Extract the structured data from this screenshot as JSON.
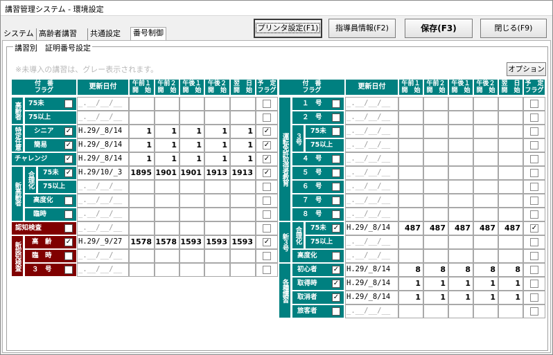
{
  "window": {
    "title": "講習管理システム - 環境設定"
  },
  "buttons": {
    "printer": "プリンタ設定(F1)",
    "instructor": "指導員情報(F2)",
    "save": "保存(F3)",
    "close": "閉じる(F9)",
    "option": "オプション"
  },
  "tabs": [
    "システム",
    "高齢者講習",
    "共通設定",
    "番号制御"
  ],
  "group_label": "講習別　証明番号設定",
  "note": "※未導入の講習は、グレー表示されます。",
  "headers": {
    "flag": "付　番\nフラグ",
    "date": "更新日付",
    "am1": "午前１\n開　始",
    "am2": "午前２\n開　始",
    "pm1": "午後１\n開　始",
    "pm2": "午後２\n開　始",
    "next": "翌　日\n開　始",
    "yotei": "予　定\nフラグ"
  },
  "blank_date": "_.__/__/__",
  "left": {
    "g_koreisha": "高齢者",
    "g_tokutei": "特定任意",
    "g_shinkorei": "新高齢者",
    "g_gouri": "合理化",
    "g_shinninchi": "新認知検査",
    "l_75mi": "75未",
    "l_75ijo": "75以上",
    "l_senior": "シニア",
    "l_kantan": "簡易",
    "l_challenge": "チャレンジ",
    "l_kodoka": "高度化",
    "l_rinji": "臨時",
    "l_ninchi": "認知検査",
    "l_korei": "高　齢",
    "l_rinji2": "臨　時",
    "l_3go": "３　号",
    "rows": {
      "senior": {
        "date": "H.29/_8/14",
        "v": [
          "1",
          "1",
          "1",
          "1",
          "1"
        ]
      },
      "kantan": {
        "date": "H.29/_8/14",
        "v": [
          "1",
          "1",
          "1",
          "1",
          "1"
        ]
      },
      "gouri75": {
        "date": "H.29/10/_3",
        "v": [
          "1895",
          "1901",
          "1901",
          "1913",
          "1913"
        ]
      },
      "korei": {
        "date": "H.29/_9/27",
        "v": [
          "1578",
          "1578",
          "1593",
          "1593",
          "1593"
        ]
      }
    }
  },
  "right": {
    "g_unten": "運転免許取得者教育",
    "g_3go": "３号",
    "g_shin3go": "新３号",
    "g_gouri": "合理化",
    "g_kakushu": "各種講習",
    "l_1go": "１　号",
    "l_2go": "２　号",
    "l_75mi": "75未",
    "l_75ijo": "75以上",
    "l_4go": "４　号",
    "l_5go": "５　号",
    "l_6go": "６　号",
    "l_7go": "７　号",
    "l_8go": "８　号",
    "l_kodoka": "高度化",
    "l_shoshinsha": "初心者",
    "l_shutokuji": "取得時",
    "l_torikeshi": "取消者",
    "l_ryokaku": "旅客者",
    "rows": {
      "shin3go75": {
        "date": "H.29/_8/14",
        "v": [
          "487",
          "487",
          "487",
          "487",
          "487"
        ]
      },
      "shoshinsha": {
        "date": "H.29/_8/14",
        "v": [
          "8",
          "8",
          "8",
          "8",
          "8"
        ]
      },
      "shutokuji": {
        "date": "H.29/_8/14",
        "v": [
          "1",
          "1",
          "1",
          "1",
          "1"
        ]
      },
      "torikeshi": {
        "date": "H.29/_8/14",
        "v": [
          "1",
          "1",
          "1",
          "1",
          "1"
        ]
      }
    }
  },
  "check": "✓"
}
